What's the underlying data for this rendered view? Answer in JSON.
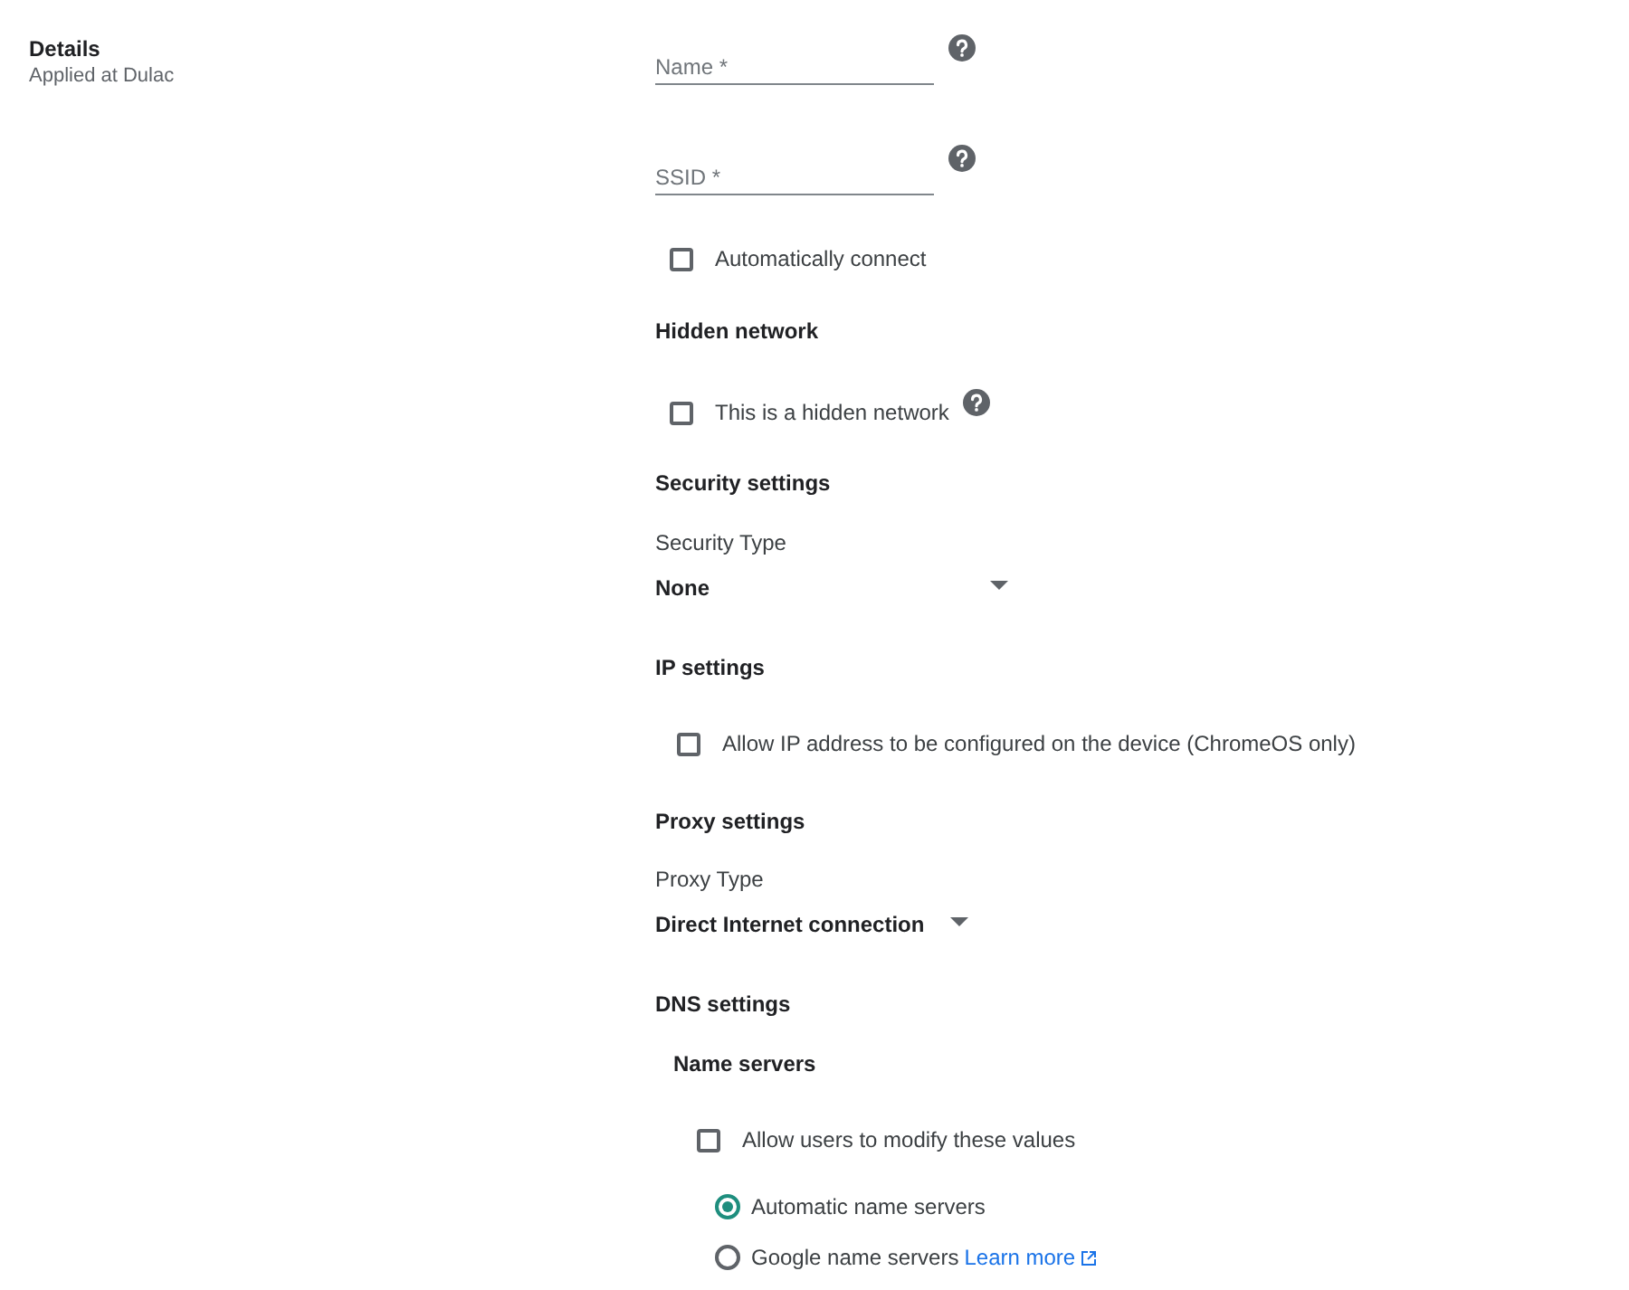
{
  "details": {
    "title": "Details",
    "subtitle": "Applied at Dulac"
  },
  "form": [
    {
      "kind": "field",
      "placeholder": "Name *",
      "help": true
    },
    {
      "kind": "field",
      "placeholder": "SSID *",
      "help": true
    },
    {
      "kind": "checkbox",
      "label": "Automatically connect",
      "checked": false,
      "help": false
    },
    {
      "kind": "heading",
      "text": "Hidden network"
    },
    {
      "kind": "checkbox",
      "label": "This is a hidden network",
      "checked": false,
      "help": true
    },
    {
      "kind": "heading",
      "text": "Security settings"
    },
    {
      "kind": "label",
      "text": "Security Type"
    },
    {
      "kind": "select",
      "value": "None"
    },
    {
      "kind": "heading",
      "text": "IP settings"
    },
    {
      "kind": "checkbox",
      "label": "Allow IP address to be configured on the device (ChromeOS only)",
      "checked": false,
      "help": false
    },
    {
      "kind": "heading",
      "text": "Proxy settings"
    },
    {
      "kind": "label",
      "text": "Proxy Type"
    },
    {
      "kind": "select",
      "value": "Direct Internet connection"
    },
    {
      "kind": "heading",
      "text": "DNS settings"
    },
    {
      "kind": "heading",
      "text": "Name servers"
    },
    {
      "kind": "checkbox",
      "label": "Allow users to modify these values",
      "checked": false,
      "help": false
    },
    {
      "kind": "radio",
      "label": "Automatic name servers",
      "selected": true
    },
    {
      "kind": "radio",
      "label": "Google name servers",
      "selected": false,
      "link": "Learn more"
    }
  ]
}
